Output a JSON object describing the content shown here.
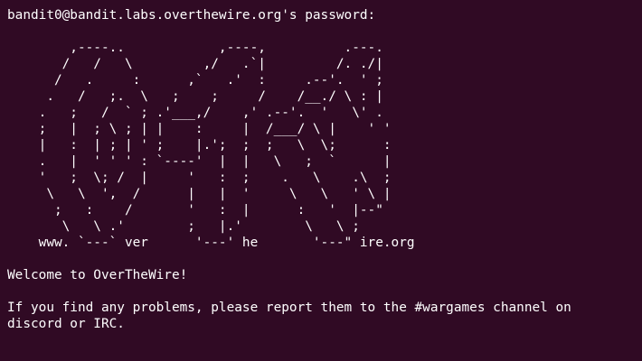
{
  "terminal": {
    "prompt": "bandit0@bandit.labs.overthewire.org's password:",
    "ascii_art": [
      "        ,----..            ,----,          .---.",
      "       /   /   \\         ,/   .`|         /. ./|",
      "      /   .     :      ,`   .'  :     .--'.  ' ;",
      "     .   /   ;.  \\   ;    ;     /    /__./ \\ : |",
      "    .   ;   /  ` ; .'___,/    ,' .--'.  '   \\' .",
      "    ;   |  ; \\ ; | |    :     |  /___/ \\ |    ' '",
      "    |   :  | ; | ' ;    |.';  ;  ;   \\  \\;      :",
      "    .   |  ' ' ' : `----'  |  |   \\   ;  `      |",
      "    '   ;  \\; /  |     '   :  ;    .   \\    .\\  ;",
      "     \\   \\  ',  /      |   |  '     \\   \\   ' \\ |",
      "      ;   :    /       '   :  |      :   '  |--\"",
      "       \\   \\ .'        ;   |.'        \\   \\ ;",
      "    www. `---` ver      '---' he       '---\" ire.org"
    ],
    "welcome": "Welcome to OverTheWire!",
    "info_lines": [
      "If you find any problems, please report them to the #wargames channel on",
      "discord or IRC."
    ]
  },
  "colors": {
    "background": "#300a24",
    "foreground": "#ffffff"
  }
}
